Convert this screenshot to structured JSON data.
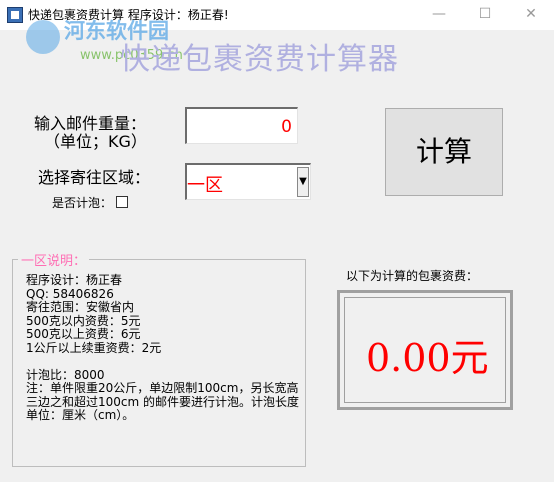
{
  "window": {
    "title": "快递包裹资费计算  程序设计：杨正春!",
    "min_symbol": "—",
    "max_symbol": "☐",
    "close_symbol": "✕"
  },
  "watermark": {
    "site_name": "河东软件园",
    "site_url": "www.pc0359.cn"
  },
  "heading": "快递包裹资费计算器",
  "form": {
    "weight_label": "输入邮件重量：",
    "unit_label": "（单位；KG）",
    "weight_value": "0",
    "zone_label": "选择寄往区域：",
    "zone_value": "一区",
    "foam_label": "是否计泡：",
    "foam_checked": false,
    "calc_button": "计算"
  },
  "description": {
    "legend": "一区说明：",
    "lines": [
      "程序设计：杨正春",
      "QQ: 58406826",
      "寄往范围：安徽省内",
      "500克以内资费：5元",
      "500克以上资费：6元",
      "1公斤以上续重资费：2元"
    ],
    "foam_ratio": "计泡比：8000",
    "note": "注：单件限重20公斤，单边限制100cm，另长宽高三边之和超过100cm 的邮件要进行计泡。计泡长度单位：厘米（cm）。"
  },
  "result": {
    "label": "以下为计算的包裹资费：",
    "value": "0.00元"
  },
  "colors": {
    "accent_red": "#ff0000",
    "legend_pink": "#ff6eb4",
    "heading_lavender": "#b0b0e0"
  },
  "icons": {
    "app": "app-icon",
    "dropdown": "chevron-down-icon"
  }
}
